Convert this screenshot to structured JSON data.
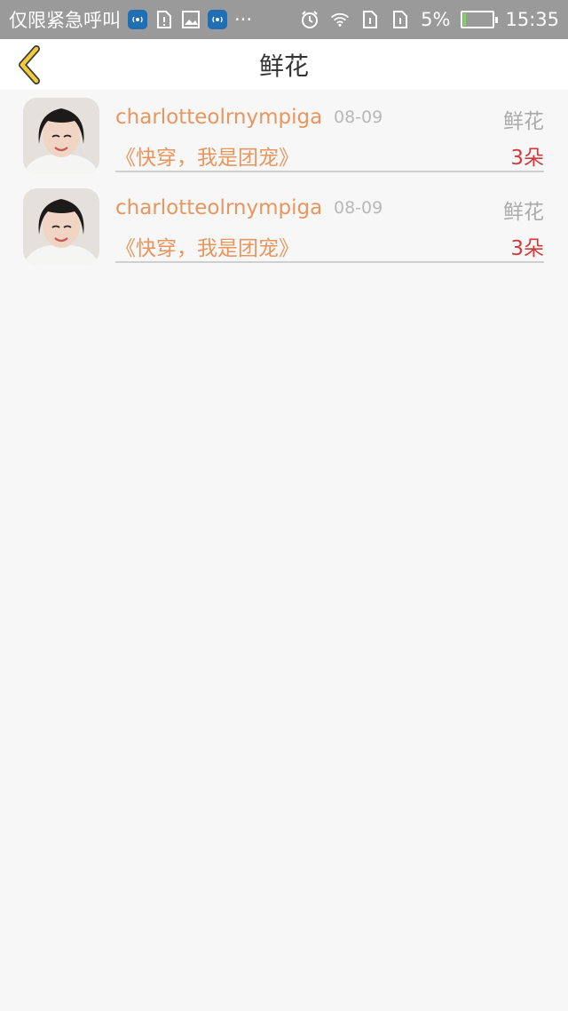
{
  "status_bar": {
    "carrier": "仅限紧急呼叫",
    "more": "···",
    "battery_percent": "5%",
    "time": "15:35",
    "icons": [
      "app-badge-icon",
      "sim-warning-icon",
      "image-icon",
      "app-badge-icon",
      "alarm-icon",
      "wifi-icon",
      "sim1-icon",
      "sim2-icon",
      "battery-charging-icon"
    ]
  },
  "header": {
    "title": "鲜花",
    "back_icon": "chevron-left-icon",
    "accent": "#f0cc3c"
  },
  "records": [
    {
      "username": "charlotteolrnympiga",
      "date": "08-09",
      "gift": "鲜花",
      "book": "《快穿，我是团宠》",
      "count": "3朵"
    },
    {
      "username": "charlotteolrnympiga",
      "date": "08-09",
      "gift": "鲜花",
      "book": "《快穿，我是团宠》",
      "count": "3朵"
    }
  ],
  "colors": {
    "username": "#e8965e",
    "count": "#d33a3a",
    "muted": "#aaaaaa"
  }
}
